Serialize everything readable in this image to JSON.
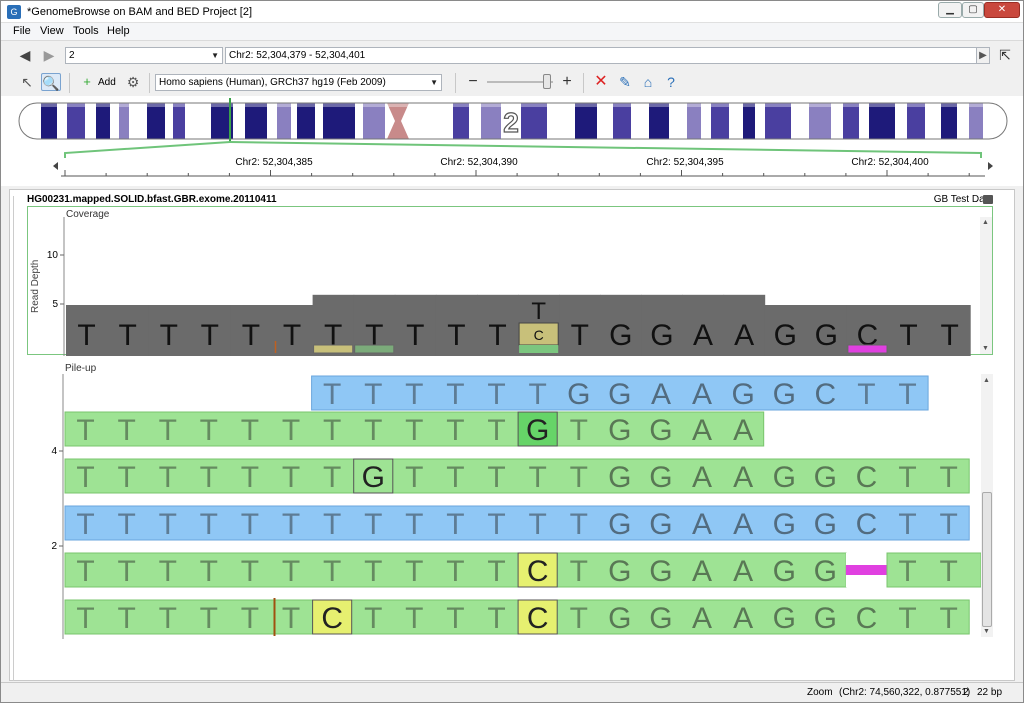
{
  "window": {
    "title": "*GenomeBrowse on BAM and BED Project [2]",
    "app_icon": "app-icon",
    "minimize": "▁",
    "maximize": "▢",
    "close": "✕"
  },
  "menu": [
    "File",
    "View",
    "Tools",
    "Help"
  ],
  "nav": {
    "chromosome": "2",
    "location": "Chr2: 52,304,379 - 52,304,401"
  },
  "toolbar": {
    "add_label": "Add",
    "genome": "Homo sapiens (Human), GRCh37 hg19 (Feb 2009)",
    "zoom_minus": "−",
    "zoom_plus": "+"
  },
  "ideogram": {
    "chromosome_label": "2"
  },
  "ruler": {
    "ticks": [
      "Chr2: 52,304,385",
      "Chr2: 52,304,390",
      "Chr2: 52,304,395",
      "Chr2: 52,304,400"
    ]
  },
  "track": {
    "name": "HG00231.mapped.SOLID.bfast.GBR.exome.20110411",
    "source": "GB Test Data"
  },
  "coverage": {
    "label": "Coverage",
    "axis_label": "Read Depth",
    "ticks": [
      "10",
      "5"
    ],
    "ref_bases": [
      "T",
      "T",
      "T",
      "T",
      "T",
      "T",
      "T",
      "T",
      "T",
      "T",
      "T",
      "C",
      "T",
      "G",
      "G",
      "A",
      "A",
      "G",
      "G",
      "C",
      "T",
      "T"
    ],
    "alt_top": "T",
    "alt_inner": "C",
    "colors": {
      "coverage": "#6b6b6b",
      "insertion": "#e040e0",
      "variant": "#c8c07a",
      "green": "#7bc67f"
    }
  },
  "pileup": {
    "label": "Pile-up",
    "ticks": [
      "4",
      "2"
    ],
    "rows": [
      {
        "color": "blue",
        "bases": [
          "T",
          "T",
          "T",
          "T",
          "T",
          "T",
          "G",
          "G",
          "A",
          "A",
          "G",
          "G",
          "C",
          "T",
          "T"
        ],
        "start": 6
      },
      {
        "color": "green",
        "bases": [
          "T",
          "T",
          "T",
          "T",
          "T",
          "T",
          "T",
          "T",
          "T",
          "T",
          "T",
          "G",
          "T",
          "G",
          "G",
          "A",
          "A"
        ],
        "start": 0,
        "highlight": 11,
        "hl_base": "G"
      },
      {
        "color": "green",
        "bases": [
          "T",
          "T",
          "T",
          "T",
          "T",
          "T",
          "T",
          "G",
          "T",
          "T",
          "T",
          "T",
          "T",
          "G",
          "G",
          "A",
          "A",
          "G",
          "G",
          "C",
          "T",
          "T"
        ],
        "start": 0,
        "highlight": 7,
        "hl_base": "G"
      },
      {
        "color": "blue",
        "bases": [
          "T",
          "T",
          "T",
          "T",
          "T",
          "T",
          "T",
          "T",
          "T",
          "T",
          "T",
          "T",
          "T",
          "G",
          "G",
          "A",
          "A",
          "G",
          "G",
          "C",
          "T",
          "T"
        ],
        "start": 0
      },
      {
        "color": "green",
        "bases": [
          "T",
          "T",
          "T",
          "T",
          "T",
          "T",
          "T",
          "T",
          "T",
          "T",
          "T",
          "C",
          "T",
          "G",
          "G",
          "A",
          "A",
          "G",
          "G",
          "",
          "T",
          "T"
        ],
        "start": 0,
        "highlight": 11,
        "hl_base": "C",
        "insert_at": 19
      },
      {
        "color": "green",
        "bases": [
          "T",
          "T",
          "T",
          "T",
          "T",
          "T",
          "C",
          "T",
          "T",
          "T",
          "T",
          "C",
          "T",
          "G",
          "G",
          "A",
          "A",
          "G",
          "G",
          "C",
          "T",
          "T"
        ],
        "start": 0,
        "highlight": 11,
        "hl_base": "C",
        "highlight2": 6,
        "hl_base2": "C"
      }
    ]
  },
  "status": {
    "mode": "Zoom",
    "coords": "(Chr2: 74,560,322, 0.877551)",
    "count": "2",
    "bp": "22 bp"
  }
}
